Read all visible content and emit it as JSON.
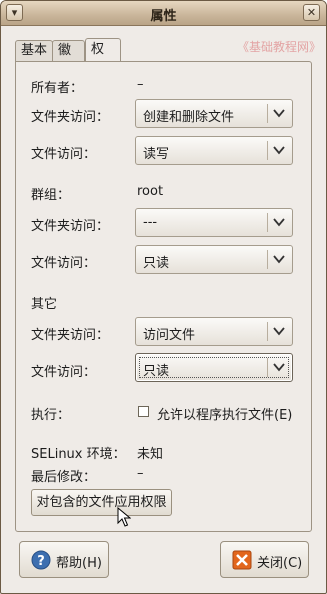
{
  "window": {
    "title": "属性"
  },
  "tabs": [
    {
      "label": "基本"
    },
    {
      "label": "徽标"
    },
    {
      "label": "权限",
      "active": true
    }
  ],
  "watermark": "《基础教程网》",
  "owner": {
    "label": "所有者：",
    "value": "–"
  },
  "owner_folder_access": {
    "label": "文件夹访问：",
    "value": "创建和删除文件"
  },
  "owner_file_access": {
    "label": "文件访问：",
    "value": "读写"
  },
  "group": {
    "label": "群组：",
    "value": "root"
  },
  "group_folder_access": {
    "label": "文件夹访问：",
    "value": "---"
  },
  "group_file_access": {
    "label": "文件访问：",
    "value": "只读"
  },
  "others": {
    "heading": "其它"
  },
  "others_folder_access": {
    "label": "文件夹访问：",
    "value": "访问文件"
  },
  "others_file_access": {
    "label": "文件访问：",
    "value": "只读"
  },
  "execute": {
    "label": "执行：",
    "checkbox_label": "允许以程序执行文件(E)",
    "checked": false
  },
  "selinux": {
    "label": "SELinux 环境：",
    "value": "未知"
  },
  "last_modified": {
    "label": "最后修改：",
    "value": "–"
  },
  "apply_button": "对包含的文件应用权限",
  "buttons": {
    "help": "帮助(H)",
    "close": "关闭(C)"
  },
  "colors": {
    "titlebar": "#c9b59a",
    "background": "#efebe7",
    "help_icon": "#3d6fb0",
    "close_icon": "#e2661c"
  },
  "icons": {
    "menu": "window-menu-icon",
    "close": "window-close-icon",
    "help": "help-icon",
    "closebtn": "close-x-icon",
    "dropdown": "chevron-down-icon"
  }
}
